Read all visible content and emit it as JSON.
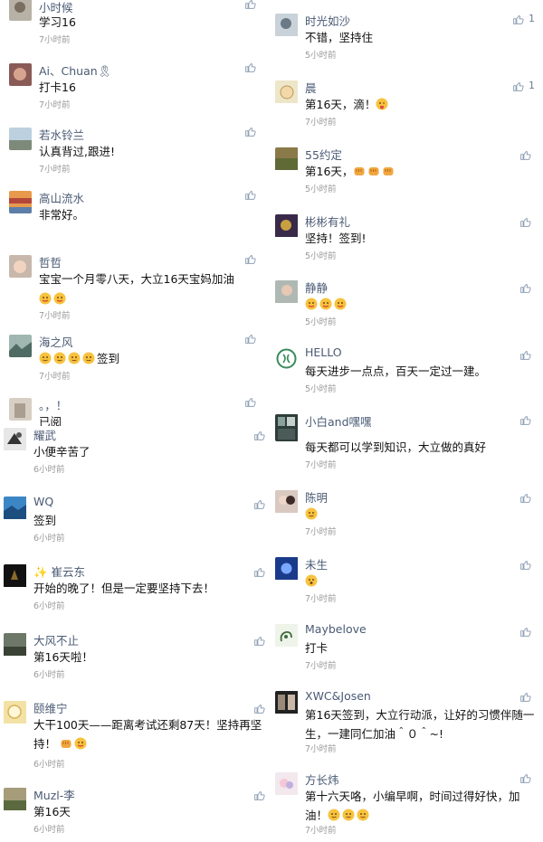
{
  "time_label": "7小时前",
  "left": {
    "c1": {
      "name": "小时候",
      "text": "学习16",
      "time": "7小时前"
    },
    "c2": {
      "name": "Ai、Chuan🎗",
      "text": "打卡16",
      "time": "7小时前"
    },
    "c3": {
      "name": "若水铃兰",
      "text": "认真背过,跟进!",
      "time": "7小时前"
    },
    "c4": {
      "name": "高山流水",
      "text": "非常好。",
      "time": "7小时前"
    },
    "c5": {
      "name": "哲哲",
      "text": "宝宝一个月零八天，大立16天宝妈加油",
      "time": "7小时前"
    },
    "c6": {
      "name": "海之风",
      "text": "签到",
      "time": "7小时前"
    },
    "c7": {
      "name": "。，！",
      "text": "已阅"
    },
    "c8": {
      "name": "耀武",
      "text": "小便辛苦了",
      "time": "6小时前"
    },
    "c9": {
      "name": "WQ",
      "text": "签到",
      "time": "6小时前"
    },
    "c10": {
      "name": "✨ 崔云东",
      "text": "开始的晚了！但是一定要坚持下去！",
      "time": "6小时前"
    },
    "c11": {
      "name": "大风不止",
      "text": "第16天啦！",
      "time": "6小时前"
    },
    "c12": {
      "name": "颐维宁",
      "text": "大干100天——距离考试还剩87天！坚持再坚持！",
      "time": "6小时前"
    },
    "c13": {
      "name": "Muzl-李",
      "text": "第16天",
      "time": "6小时前"
    }
  },
  "right": {
    "c1": {
      "name": "时光如沙",
      "text": "不错，坚持住",
      "time": "5小时前",
      "likes": "1"
    },
    "c2": {
      "name": "晨",
      "text": "第16天，滴！",
      "time": "7小时前",
      "likes": "1"
    },
    "c3": {
      "name": "55约定",
      "text": "第16天，",
      "time": "5小时前"
    },
    "c4": {
      "name": "彬彬有礼",
      "text": "坚持！签到!",
      "time": "5小时前"
    },
    "c5": {
      "name": "静静",
      "text": "",
      "time": "5小时前"
    },
    "c6": {
      "name": "HELLO",
      "text": "每天进步一点点，百天一定过一建。",
      "time": "5小时前"
    },
    "c7": {
      "name": "小白and嘿嘿",
      "text": "每天都可以学到知识，大立做的真好",
      "time": "7小时前"
    },
    "c8": {
      "name": "陈明",
      "text": "",
      "time": "7小时前"
    },
    "c9": {
      "name": "未生",
      "text": "",
      "time": "7小时前"
    },
    "c10": {
      "name": "Maybelove",
      "text": "打卡",
      "time": "7小时前"
    },
    "c11": {
      "name": "XWC&Josen",
      "text": "第16天签到，大立行动派，让好的习惯伴随一生，一建同仁加油＾０＾~!",
      "time": "7小时前"
    },
    "c12": {
      "name": "方长炜",
      "text": "第十六天咯，小编早啊，时间过得好快，加油！",
      "time": "7小时前"
    }
  },
  "icons": {
    "like": "thumbs-up-icon"
  }
}
